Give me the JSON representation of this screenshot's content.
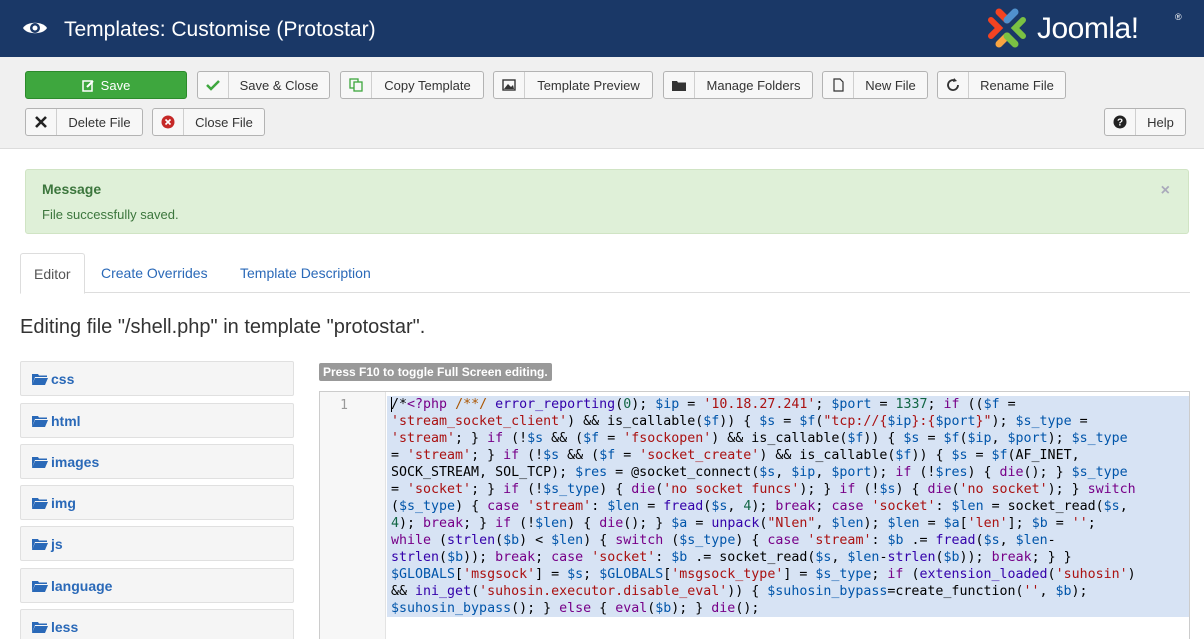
{
  "header": {
    "title": "Templates: Customise (Protostar)",
    "logo_text": "Joomla!",
    "logo_reg": "®"
  },
  "toolbar": {
    "save": "Save",
    "save_close": "Save & Close",
    "copy_template": "Copy Template",
    "template_preview": "Template Preview",
    "manage_folders": "Manage Folders",
    "new_file": "New File",
    "rename_file": "Rename File",
    "delete_file": "Delete File",
    "close_file": "Close File",
    "help": "Help"
  },
  "message": {
    "heading": "Message",
    "text": "File successfully saved.",
    "close": "×"
  },
  "tabs": [
    "Editor",
    "Create Overrides",
    "Template Description"
  ],
  "editing_title": "Editing file \"/shell.php\" in template \"protostar\".",
  "tree": [
    "css",
    "html",
    "images",
    "img",
    "js",
    "language",
    "less"
  ],
  "editor": {
    "hint": "Press F10 to toggle Full Screen editing.",
    "line_number": "1"
  },
  "colors": {
    "header_bg": "#1a3867",
    "save_bg": "#3ea73e",
    "link": "#2a69b8",
    "alert_bg": "#dff0d8",
    "selection": "#d7e3f4"
  }
}
